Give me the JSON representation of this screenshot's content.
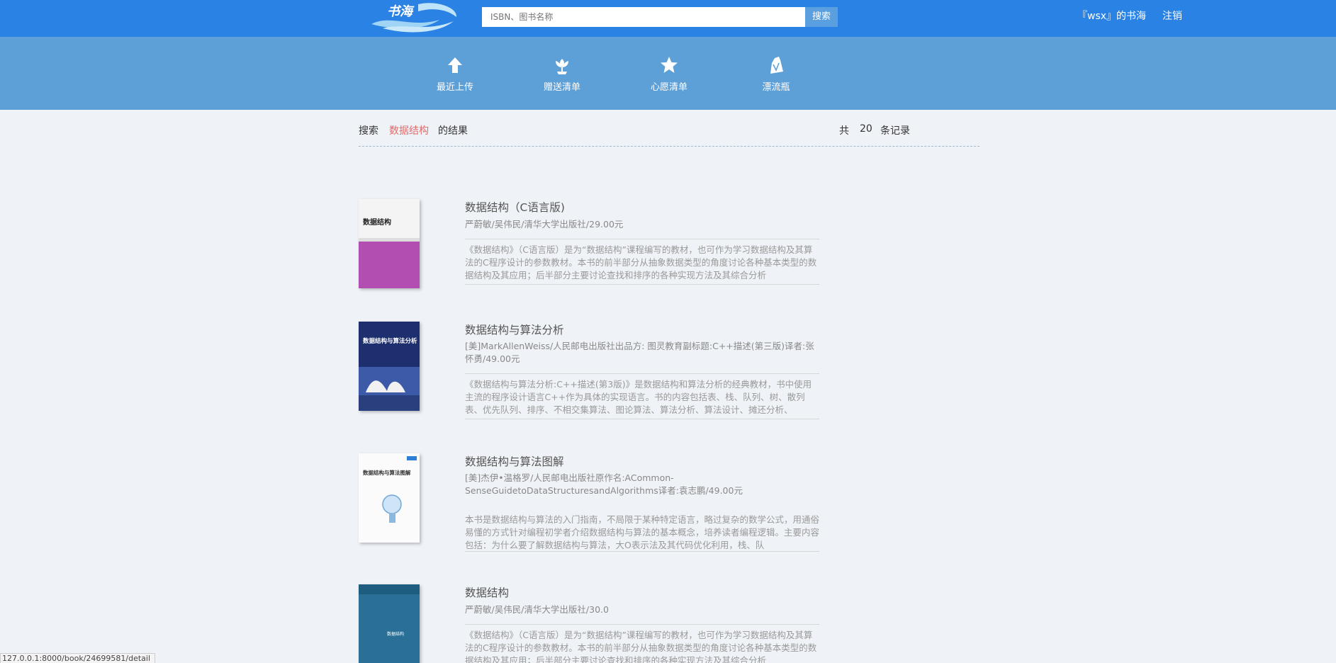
{
  "header": {
    "logo_text": "书海",
    "search_placeholder": "ISBN、图书名称",
    "search_button": "搜索",
    "user_link": "『wsx』的书海",
    "logout": "注销"
  },
  "nav": {
    "items": [
      {
        "label": "最近上传",
        "icon": "upload-arrow-icon"
      },
      {
        "label": "赠送清单",
        "icon": "flower-icon"
      },
      {
        "label": "心愿清单",
        "icon": "star-icon"
      },
      {
        "label": "漂流瓶",
        "icon": "bottle-icon"
      }
    ]
  },
  "results": {
    "prefix": "搜索",
    "keyword": "数据结构",
    "suffix": "的结果",
    "count_prefix": "共",
    "count": "20",
    "count_suffix": "条记录"
  },
  "books": [
    {
      "title": "数据结构（C语言版)",
      "meta": " 严蔚敏/吴伟民/清华大学出版社/29.00元",
      "desc": "《数据结构》（C语言版）是为“数据结构”课程编写的教材，也可作为学习数据结构及其算法的C程序设计的参数教材。本书的前半部分从抽象数据类型的角度讨论各种基本类型的数据结构及其应用；后半部分主要讨论查找和排序的各种实现方法及其综合分析",
      "cover_text": "数据结构"
    },
    {
      "title": "数据结构与算法分析",
      "meta": " [美]MarkAllenWeiss/人民邮电出版社出品方: 图灵教育副标题:C++描述(第三版)译者:张怀勇/49.00元",
      "desc": "《数据结构与算法分析:C++描述(第3版)》是数据结构和算法分析的经典教材，书中使用主流的程序设计语言C++作为具体的实现语言。书的内容包括表、栈、队列、树、散列表、优先队列、排序、不相交集算法、图论算法、算法分析、算法设计、摊还分析、",
      "cover_text": "数据结构与算法分析"
    },
    {
      "title": "数据结构与算法图解",
      "meta": "[美]杰伊•温格罗/人民邮电出版社原作名:ACommon-SenseGuidetoDataStructuresandAlgorithms译者:袁志鹏/49.00元",
      "desc": "本书是数据结构与算法的入门指南，不局限于某种特定语言，略过复杂的数学公式，用通俗易懂的方式针对编程初学者介绍数据结构与算法的基本概念，培养读者编程逻辑。主要内容包括：为什么要了解数据结构与算法，大O表示法及其代码优化利用，栈、队",
      "cover_text": "数据结构与算法图解"
    },
    {
      "title": "数据结构",
      "meta": "严蔚敏/吴伟民/清华大学出版社/30.0",
      "desc": "《数据结构》（C语言版）是为“数据结构”课程编写的教材，也可作为学习数据结构及其算法的C程序设计的参数教材。本书的前半部分从抽象数据类型的角度讨论各种基本类型的数据结构及其应用；后半部分主要讨论查找和排序的各种实现方法及其综合分析",
      "cover_text": "数据结构"
    }
  ],
  "status_url": "127.0.0.1:8000/book/24699581/detail"
}
